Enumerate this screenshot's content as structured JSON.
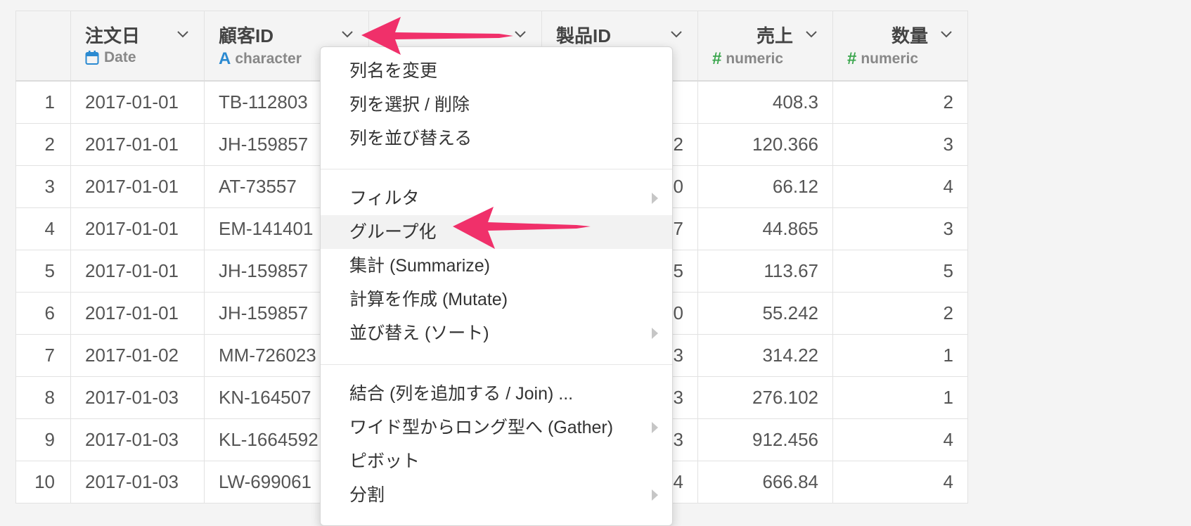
{
  "columns": [
    {
      "name": "",
      "type": "",
      "icon": ""
    },
    {
      "name": "注文日",
      "type": "Date",
      "icon": "calendar-icon"
    },
    {
      "name": "顧客ID",
      "type": "character",
      "icon": "character-type-icon"
    },
    {
      "name": "",
      "type": "",
      "icon": ""
    },
    {
      "name": "製品ID",
      "type": "",
      "icon": ""
    },
    {
      "name": "売上",
      "type": "numeric",
      "icon": "numeric-type-icon"
    },
    {
      "name": "数量",
      "type": "numeric",
      "icon": "numeric-type-icon"
    }
  ],
  "rows": [
    {
      "num": "1",
      "date": "2017-01-01",
      "cust": "TB-112803",
      "c4": "",
      "prod": "",
      "sales": "408.3",
      "qty": "2"
    },
    {
      "num": "2",
      "date": "2017-01-01",
      "cust": "JH-159857",
      "c4": "",
      "prod": "2",
      "sales": "120.366",
      "qty": "3"
    },
    {
      "num": "3",
      "date": "2017-01-01",
      "cust": "AT-73557",
      "c4": "",
      "prod": "0",
      "sales": "66.12",
      "qty": "4"
    },
    {
      "num": "4",
      "date": "2017-01-01",
      "cust": "EM-141401",
      "c4": "",
      "prod": "7",
      "sales": "44.865",
      "qty": "3"
    },
    {
      "num": "5",
      "date": "2017-01-01",
      "cust": "JH-159857",
      "c4": "",
      "prod": "5",
      "sales": "113.67",
      "qty": "5"
    },
    {
      "num": "6",
      "date": "2017-01-01",
      "cust": "JH-159857",
      "c4": "",
      "prod": "0",
      "sales": "55.242",
      "qty": "2"
    },
    {
      "num": "7",
      "date": "2017-01-02",
      "cust": "MM-726023",
      "c4": "",
      "prod": "3",
      "sales": "314.22",
      "qty": "1"
    },
    {
      "num": "8",
      "date": "2017-01-03",
      "cust": "KN-164507",
      "c4": "",
      "prod": "3",
      "sales": "276.102",
      "qty": "1"
    },
    {
      "num": "9",
      "date": "2017-01-03",
      "cust": "KL-1664592",
      "c4": "",
      "prod": "3",
      "sales": "912.456",
      "qty": "4"
    },
    {
      "num": "10",
      "date": "2017-01-03",
      "cust": "LW-699061",
      "c4": "",
      "prod": "4",
      "sales": "666.84",
      "qty": "4"
    }
  ],
  "menu": {
    "rename": "列名を変更",
    "select_delete": "列を選択 / 削除",
    "reorder": "列を並び替える",
    "filter": "フィルタ",
    "group_by": "グループ化",
    "summarize": "集計 (Summarize)",
    "mutate": "計算を作成 (Mutate)",
    "sort": "並び替え (ソート)",
    "join": "結合 (列を追加する / Join) ...",
    "gather": "ワイド型からロング型へ (Gather)",
    "pivot": "ピボット",
    "split": "分割"
  },
  "colors": {
    "arrow": "#f0306a",
    "date_icon": "#2b8ad1",
    "numeric_icon": "#3aa64d"
  }
}
